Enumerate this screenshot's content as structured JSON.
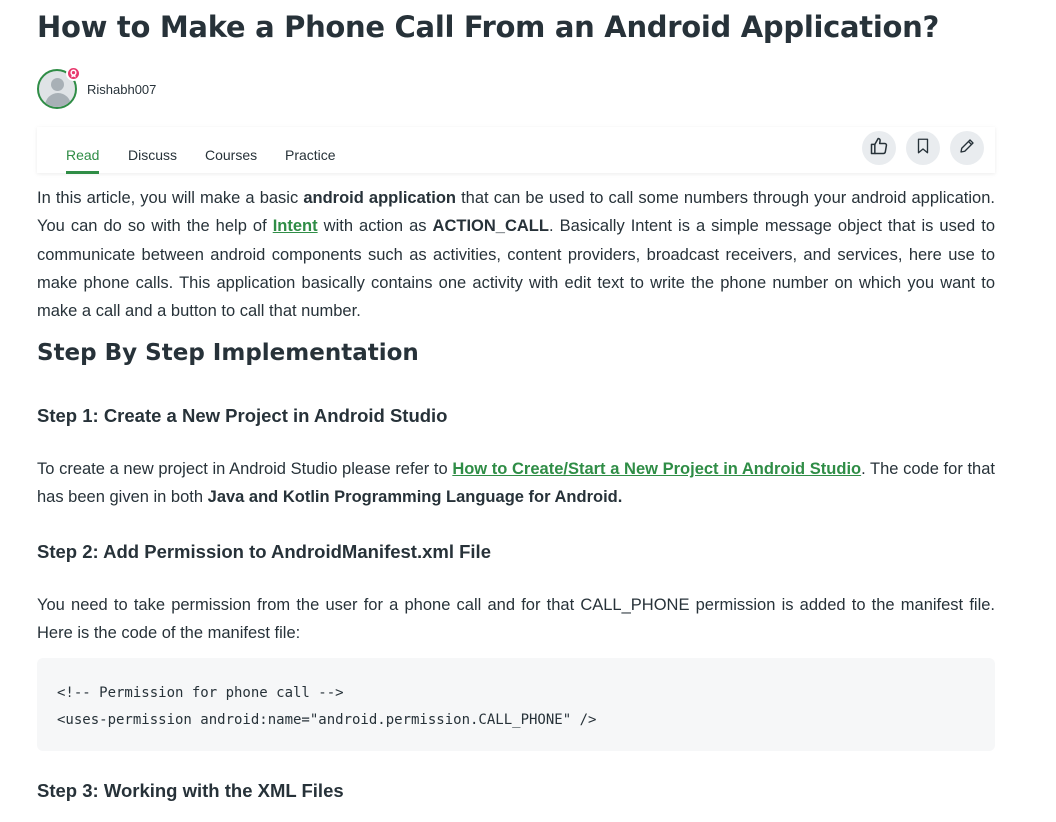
{
  "article": {
    "title": "How to Make a Phone Call From an Android Application?",
    "author": "Rishabh007"
  },
  "tabs": [
    "Read",
    "Discuss",
    "Courses",
    "Practice"
  ],
  "actions": {
    "like_icon": "thumbs-up-icon",
    "bookmark_icon": "bookmark-icon",
    "edit_icon": "pencil-icon"
  },
  "intro": {
    "t1": "In this article, you will make a basic ",
    "b1": "android application",
    "t2": " that can be used to call some numbers through your android application. You can do so with the help of ",
    "link": "Intent",
    "t3": " with action as ",
    "b2": "ACTION_CALL",
    "t4": ". Basically Intent is a simple message object that is used to communicate between android components such as activities, content providers, broadcast receivers, and services, here use to make phone calls. This application basically contains one activity with edit text to write the phone number on which you want to make a call and a button to call that number."
  },
  "section_title": "Step By Step Implementation",
  "step1": {
    "heading": "Step 1: Create a New Project in Android Studio",
    "t1": "To create a new project in Android Studio please refer to ",
    "link": "How to Create/Start a New Project in Android Studio",
    "t2": ". The code for that has been given in both ",
    "b1": "Java and Kotlin Programming Language for Android."
  },
  "step2": {
    "heading": "Step 2: Add Permission to AndroidManifest.xml File",
    "text": "You need to take permission from the user for a phone call and for that CALL_PHONE permission is added to the manifest file. Here is the code of the manifest file:",
    "code": [
      "<!-- Permission for phone call -->",
      "<uses-permission android:name=\"android.permission.CALL_PHONE\" />"
    ]
  },
  "step3": {
    "heading": "Step 3: Working with the XML Files"
  },
  "colors": {
    "accent": "#2f8d46",
    "text": "#273239",
    "badge": "#e8386d"
  }
}
